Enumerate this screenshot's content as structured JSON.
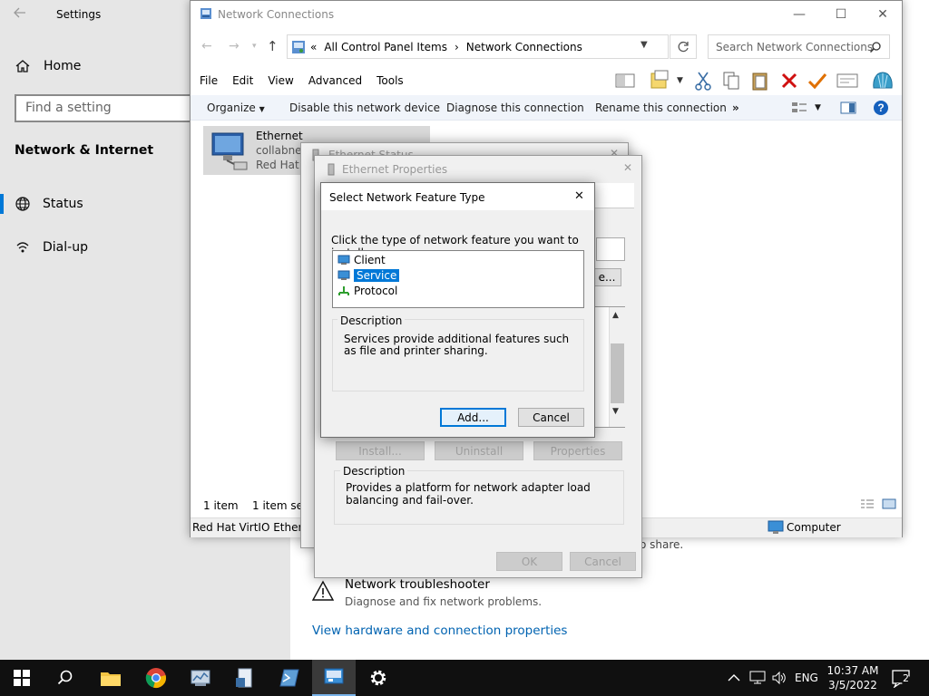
{
  "settings": {
    "title": "Settings",
    "home": "Home",
    "find_placeholder": "Find a setting",
    "section": "Network & Internet",
    "nav": [
      "Status",
      "Dial-up"
    ],
    "share_text": "o share.",
    "troubleshooter_title": "Network troubleshooter",
    "troubleshooter_sub": "Diagnose and fix network problems.",
    "hardware_link": "View hardware and connection properties"
  },
  "netconn": {
    "title": "Network Connections",
    "address": {
      "prefix": "«",
      "part1": "All Control Panel Items",
      "sep": "›",
      "part2": "Network Connections"
    },
    "search_placeholder": "Search Network Connections",
    "menu": [
      "File",
      "Edit",
      "View",
      "Advanced",
      "Tools"
    ],
    "commands": {
      "organize": "Organize",
      "disable": "Disable this network device",
      "diagnose": "Diagnose this connection",
      "rename": "Rename this connection",
      "more": "»"
    },
    "item": {
      "name": "Ethernet",
      "line2": "collabnet",
      "line3": "Red Hat V"
    },
    "status_left": "1 item",
    "status_selected": "1 item sele",
    "statusbar_device": "Red Hat VirtIO Etherne",
    "statusbar_computer": "Computer"
  },
  "eth_status": {
    "title": "Ethernet Status"
  },
  "eth_props": {
    "title": "Ethernet Properties",
    "configure_partial": "e...",
    "install": "Install...",
    "uninstall": "Uninstall",
    "properties": "Properties",
    "description_label": "Description",
    "description": "Provides a platform for network adapter load balancing and fail-over.",
    "ok": "OK",
    "cancel": "Cancel"
  },
  "feature_dialog": {
    "title": "Select Network Feature Type",
    "prompt": "Click the type of network feature you want to install:",
    "items": [
      "Client",
      "Service",
      "Protocol"
    ],
    "selected_index": 1,
    "description_label": "Description",
    "description": "Services provide additional features such as file and printer sharing.",
    "add": "Add...",
    "cancel": "Cancel"
  },
  "taskbar": {
    "lang": "ENG",
    "time": "10:37 AM",
    "date": "3/5/2022",
    "notifications": "2"
  },
  "colors": {
    "accent": "#0078d7",
    "link": "#0063b1",
    "taskbar": "#101010"
  }
}
